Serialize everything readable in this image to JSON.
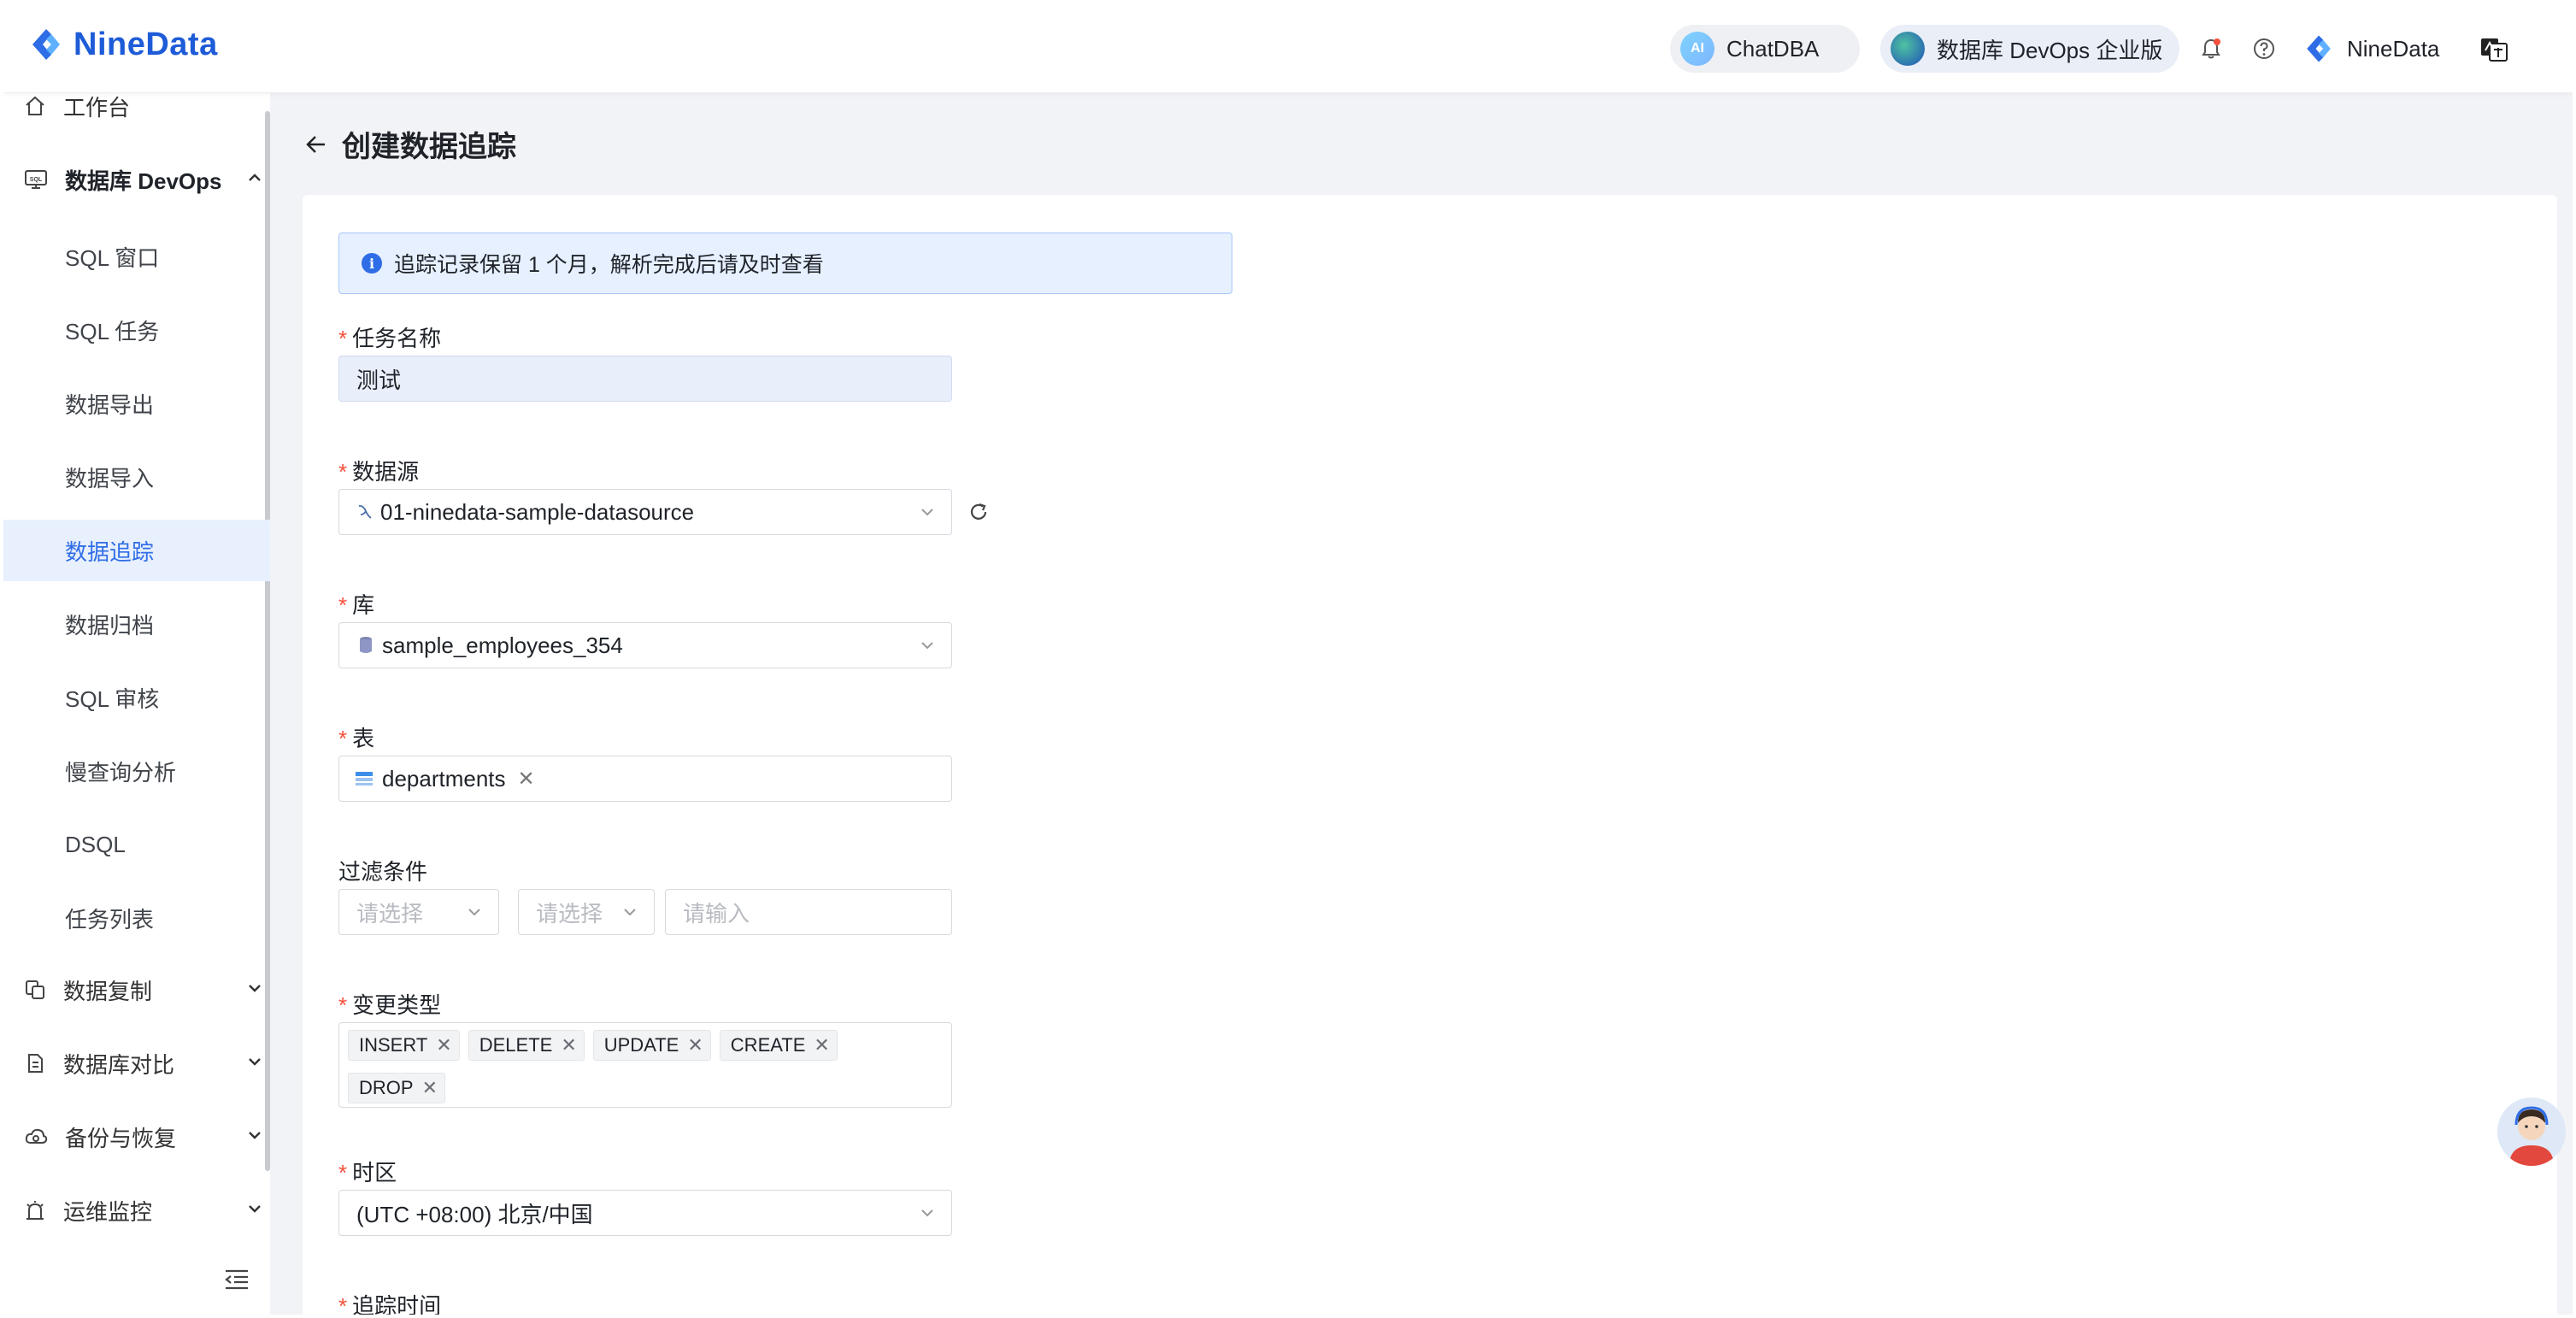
{
  "header": {
    "brand": "NineData",
    "chatdba_label": "ChatDBA",
    "chatdba_icon_text": "AI",
    "devops_label": "数据库 DevOps 企业版",
    "user_name": "NineData"
  },
  "sidebar": {
    "workbench": "工作台",
    "devops_group": "数据库 DevOps",
    "sub_items": [
      "SQL 窗口",
      "SQL 任务",
      "数据导出",
      "数据导入",
      "数据追踪",
      "数据归档",
      "SQL 审核",
      "慢查询分析",
      "DSQL",
      "任务列表"
    ],
    "active_sub": "数据追踪",
    "groups": [
      "数据复制",
      "数据库对比",
      "备份与恢复",
      "运维监控"
    ]
  },
  "page": {
    "title": "创建数据追踪"
  },
  "form": {
    "alert_text": "追踪记录保留 1 个月，解析完成后请及时查看",
    "task_name_label": "任务名称",
    "task_name_value": "测试",
    "datasource_label": "数据源",
    "datasource_value": "01-ninedata-sample-datasource",
    "database_label": "库",
    "database_value": "sample_employees_354",
    "table_label": "表",
    "table_tags": [
      "departments"
    ],
    "filter_label": "过滤条件",
    "filter_select1_placeholder": "请选择",
    "filter_select2_placeholder": "请选择",
    "filter_input_placeholder": "请输入",
    "change_type_label": "变更类型",
    "change_types": [
      "INSERT",
      "DELETE",
      "UPDATE",
      "CREATE",
      "DROP"
    ],
    "timezone_label": "时区",
    "timezone_value": "(UTC +08:00) 北京/中国",
    "track_time_label": "追踪时间"
  },
  "colors": {
    "brand": "#1e5bd8",
    "accent": "#2f6de6",
    "required": "#f5503c",
    "main_bg": "#f2f3f6"
  }
}
